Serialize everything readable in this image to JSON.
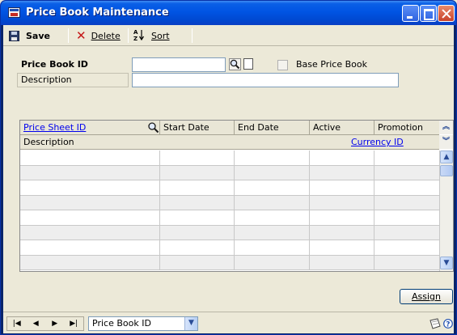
{
  "window": {
    "title": "Price Book Maintenance"
  },
  "toolbar": {
    "save_label": "Save",
    "delete_label": "Delete",
    "sort_label": "Sort"
  },
  "form": {
    "price_book_id_label": "Price Book ID",
    "price_book_id_value": "",
    "description_label": "Description",
    "description_value": "",
    "base_price_book_label": "Base Price Book",
    "base_price_book_checked": false
  },
  "grid": {
    "columns": [
      "Price Sheet ID",
      "Start Date",
      "End Date",
      "Active",
      "Promotion"
    ],
    "row2_columns": [
      "Description",
      "Currency ID"
    ],
    "rows": [
      [
        "",
        "",
        "",
        "",
        ""
      ],
      [
        "",
        "",
        "",
        "",
        ""
      ],
      [
        "",
        "",
        "",
        "",
        ""
      ],
      [
        "",
        "",
        "",
        "",
        ""
      ],
      [
        "",
        "",
        "",
        "",
        ""
      ],
      [
        "",
        "",
        "",
        "",
        ""
      ],
      [
        "",
        "",
        "",
        "",
        ""
      ],
      [
        "",
        "",
        "",
        "",
        ""
      ]
    ]
  },
  "buttons": {
    "assign_label": "Assign"
  },
  "statusbar": {
    "sort_select_value": "Price Book ID"
  },
  "icons": {
    "window": "app-window-icon",
    "save": "save-disk-icon",
    "delete": "red-x-icon",
    "sort": "sort-az-icon",
    "lookup": "magnifier-icon",
    "note": "note-icon",
    "help": "help-icon"
  }
}
